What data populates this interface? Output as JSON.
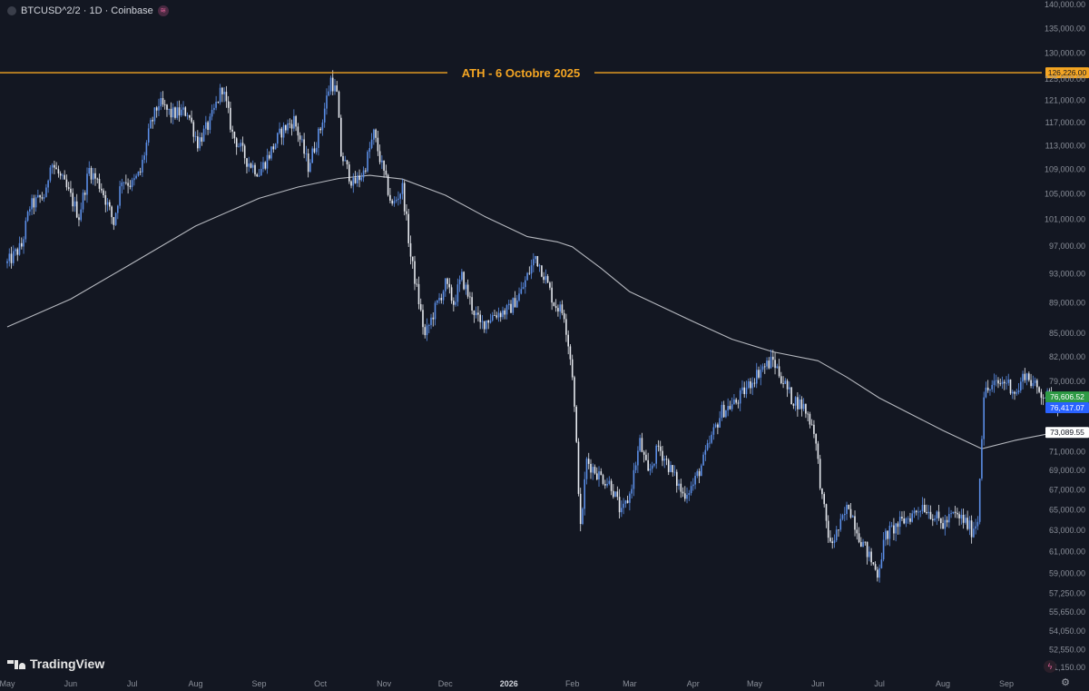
{
  "header": {
    "symbol": "BTCUSD^2/2 · 1D · Coinbase",
    "badge_icon": "status-icon"
  },
  "branding": {
    "logo_text": "TradingView"
  },
  "annotation": {
    "label": "ATH - 6 Octobre 2025",
    "value": 126226,
    "value_text": "126,226.00",
    "color": "#f5a623"
  },
  "colors": {
    "background": "#131722",
    "up": "#5b8ee6",
    "down": "#e6e9ef",
    "ma": "#c8cad0",
    "axis_text": "#8a8f99",
    "tag_green": "#2e9b45",
    "tag_blue": "#2962ff",
    "tag_white": "#ffffff"
  },
  "price_tags": [
    {
      "value": 76606.52,
      "text": "76,606.52",
      "style": "green"
    },
    {
      "value": 76417.07,
      "text": "76,417.07",
      "style": "blue"
    },
    {
      "value": 73089.55,
      "text": "73,089.55",
      "style": "white"
    }
  ],
  "chart_data": {
    "type": "candlestick",
    "title": "",
    "y_scale": "log",
    "ylim": [
      50500,
      140000
    ],
    "y_ticks": [
      {
        "value": 140000,
        "label": "140,000.00"
      },
      {
        "value": 135000,
        "label": "135,000.00"
      },
      {
        "value": 130000,
        "label": "130,000.00"
      },
      {
        "value": 125000,
        "label": "125,000.00"
      },
      {
        "value": 121000,
        "label": "121,000.00"
      },
      {
        "value": 117000,
        "label": "117,000.00"
      },
      {
        "value": 113000,
        "label": "113,000.00"
      },
      {
        "value": 109000,
        "label": "109,000.00"
      },
      {
        "value": 105000,
        "label": "105,000.00"
      },
      {
        "value": 101000,
        "label": "101,000.00"
      },
      {
        "value": 97000,
        "label": "97,000.00"
      },
      {
        "value": 93000,
        "label": "93,000.00"
      },
      {
        "value": 89000,
        "label": "89,000.00"
      },
      {
        "value": 85000,
        "label": "85,000.00"
      },
      {
        "value": 82000,
        "label": "82,000.00"
      },
      {
        "value": 79000,
        "label": "79,000.00"
      },
      {
        "value": 71000,
        "label": "71,000.00"
      },
      {
        "value": 69000,
        "label": "69,000.00"
      },
      {
        "value": 67000,
        "label": "67,000.00"
      },
      {
        "value": 65000,
        "label": "65,000.00"
      },
      {
        "value": 63000,
        "label": "63,000.00"
      },
      {
        "value": 61000,
        "label": "61,000.00"
      },
      {
        "value": 59000,
        "label": "59,000.00"
      },
      {
        "value": 57250,
        "label": "57,250.00"
      },
      {
        "value": 55650,
        "label": "55,650.00"
      },
      {
        "value": 54050,
        "label": "54,050.00"
      },
      {
        "value": 52550,
        "label": "52,550.00"
      },
      {
        "value": 51150,
        "label": "51,150.00"
      }
    ],
    "x_range": [
      "2025-05-01",
      "2026-09-30"
    ],
    "x_ticks": [
      {
        "date": "2025-05-01",
        "label": "May"
      },
      {
        "date": "2025-06-01",
        "label": "Jun"
      },
      {
        "date": "2025-07-01",
        "label": "Jul"
      },
      {
        "date": "2025-08-01",
        "label": "Aug"
      },
      {
        "date": "2025-09-01",
        "label": "Sep"
      },
      {
        "date": "2025-10-01",
        "label": "Oct"
      },
      {
        "date": "2025-11-01",
        "label": "Nov"
      },
      {
        "date": "2025-12-01",
        "label": "Dec"
      },
      {
        "date": "2026-01-01",
        "label": "2026",
        "bold": true
      },
      {
        "date": "2026-02-01",
        "label": "Feb"
      },
      {
        "date": "2026-03-01",
        "label": "Mar"
      },
      {
        "date": "2026-04-01",
        "label": "Apr"
      },
      {
        "date": "2026-05-01",
        "label": "May"
      },
      {
        "date": "2026-06-01",
        "label": "Jun"
      },
      {
        "date": "2026-07-01",
        "label": "Jul"
      },
      {
        "date": "2026-08-01",
        "label": "Aug"
      },
      {
        "date": "2026-09-01",
        "label": "Sep"
      }
    ],
    "price_path": [
      [
        "2025-05-01",
        94500
      ],
      [
        "2025-05-08",
        97000
      ],
      [
        "2025-05-12",
        103000
      ],
      [
        "2025-05-20",
        105000
      ],
      [
        "2025-05-22",
        110500
      ],
      [
        "2025-05-28",
        107000
      ],
      [
        "2025-06-01",
        104500
      ],
      [
        "2025-06-05",
        101500
      ],
      [
        "2025-06-10",
        109000
      ],
      [
        "2025-06-16",
        106000
      ],
      [
        "2025-06-22",
        100500
      ],
      [
        "2025-06-26",
        107500
      ],
      [
        "2025-07-01",
        106500
      ],
      [
        "2025-07-05",
        108500
      ],
      [
        "2025-07-10",
        116500
      ],
      [
        "2025-07-14",
        120500
      ],
      [
        "2025-07-20",
        118500
      ],
      [
        "2025-07-28",
        119000
      ],
      [
        "2025-08-02",
        113500
      ],
      [
        "2025-08-08",
        117000
      ],
      [
        "2025-08-14",
        123500
      ],
      [
        "2025-08-19",
        115000
      ],
      [
        "2025-08-26",
        110500
      ],
      [
        "2025-09-01",
        108500
      ],
      [
        "2025-09-06",
        111500
      ],
      [
        "2025-09-12",
        115500
      ],
      [
        "2025-09-18",
        117500
      ],
      [
        "2025-09-25",
        109500
      ],
      [
        "2025-10-01",
        116000
      ],
      [
        "2025-10-06",
        125000
      ],
      [
        "2025-10-09",
        122000
      ],
      [
        "2025-10-11",
        111500
      ],
      [
        "2025-10-17",
        106500
      ],
      [
        "2025-10-22",
        108500
      ],
      [
        "2025-10-27",
        115000
      ],
      [
        "2025-10-31",
        109500
      ],
      [
        "2025-11-05",
        103000
      ],
      [
        "2025-11-10",
        106000
      ],
      [
        "2025-11-14",
        95500
      ],
      [
        "2025-11-21",
        84500
      ],
      [
        "2025-11-25",
        87500
      ],
      [
        "2025-12-01",
        91500
      ],
      [
        "2025-12-05",
        89000
      ],
      [
        "2025-12-09",
        92500
      ],
      [
        "2025-12-14",
        88500
      ],
      [
        "2025-12-18",
        86000
      ],
      [
        "2025-12-25",
        87500
      ],
      [
        "2026-01-01",
        88000
      ],
      [
        "2026-01-07",
        90500
      ],
      [
        "2026-01-14",
        95500
      ],
      [
        "2026-01-18",
        93000
      ],
      [
        "2026-01-23",
        89000
      ],
      [
        "2026-01-28",
        87500
      ],
      [
        "2026-02-01",
        80000
      ],
      [
        "2026-02-05",
        63000
      ],
      [
        "2026-02-08",
        70000
      ],
      [
        "2026-02-14",
        68500
      ],
      [
        "2026-02-20",
        67500
      ],
      [
        "2026-02-25",
        64500
      ],
      [
        "2026-03-01",
        66500
      ],
      [
        "2026-03-06",
        72000
      ],
      [
        "2026-03-10",
        68500
      ],
      [
        "2026-03-15",
        71500
      ],
      [
        "2026-03-20",
        69500
      ],
      [
        "2026-03-27",
        66500
      ],
      [
        "2026-04-01",
        67500
      ],
      [
        "2026-04-06",
        70000
      ],
      [
        "2026-04-10",
        72500
      ],
      [
        "2026-04-15",
        75500
      ],
      [
        "2026-04-22",
        76500
      ],
      [
        "2026-04-28",
        78500
      ],
      [
        "2026-05-04",
        80500
      ],
      [
        "2026-05-10",
        81500
      ],
      [
        "2026-05-14",
        79500
      ],
      [
        "2026-05-19",
        77000
      ],
      [
        "2026-05-25",
        76000
      ],
      [
        "2026-05-30",
        73500
      ],
      [
        "2026-06-03",
        66000
      ],
      [
        "2026-06-07",
        61500
      ],
      [
        "2026-06-12",
        63500
      ],
      [
        "2026-06-16",
        65500
      ],
      [
        "2026-06-21",
        62500
      ],
      [
        "2026-06-26",
        60500
      ],
      [
        "2026-06-30",
        59000
      ],
      [
        "2026-07-04",
        62500
      ],
      [
        "2026-07-10",
        63500
      ],
      [
        "2026-07-17",
        64500
      ],
      [
        "2026-07-22",
        65500
      ],
      [
        "2026-07-27",
        64500
      ],
      [
        "2026-08-01",
        63500
      ],
      [
        "2026-08-06",
        64500
      ],
      [
        "2026-08-11",
        64000
      ],
      [
        "2026-08-15",
        63000
      ],
      [
        "2026-08-18",
        64000
      ],
      [
        "2026-08-21",
        77500
      ],
      [
        "2026-08-26",
        78500
      ],
      [
        "2026-09-01",
        79000
      ],
      [
        "2026-09-06",
        77500
      ],
      [
        "2026-09-10",
        80000
      ],
      [
        "2026-09-16",
        78000
      ],
      [
        "2026-09-22",
        77000
      ],
      [
        "2026-09-26",
        76400
      ]
    ],
    "moving_average": [
      [
        "2025-05-01",
        85800
      ],
      [
        "2025-06-01",
        89500
      ],
      [
        "2025-07-01",
        94500
      ],
      [
        "2025-08-01",
        100000
      ],
      [
        "2025-09-01",
        104300
      ],
      [
        "2025-09-20",
        106100
      ],
      [
        "2025-10-10",
        107500
      ],
      [
        "2025-10-25",
        108000
      ],
      [
        "2025-11-10",
        107400
      ],
      [
        "2025-12-01",
        104800
      ],
      [
        "2025-12-20",
        101500
      ],
      [
        "2026-01-10",
        98400
      ],
      [
        "2026-01-25",
        97600
      ],
      [
        "2026-02-01",
        96900
      ],
      [
        "2026-02-15",
        93800
      ],
      [
        "2026-03-01",
        90500
      ],
      [
        "2026-04-01",
        86500
      ],
      [
        "2026-04-20",
        84200
      ],
      [
        "2026-05-10",
        82600
      ],
      [
        "2026-06-01",
        81500
      ],
      [
        "2026-06-15",
        79500
      ],
      [
        "2026-07-01",
        77000
      ],
      [
        "2026-08-01",
        73300
      ],
      [
        "2026-08-20",
        71300
      ],
      [
        "2026-09-05",
        72200
      ],
      [
        "2026-09-25",
        73090
      ]
    ]
  }
}
